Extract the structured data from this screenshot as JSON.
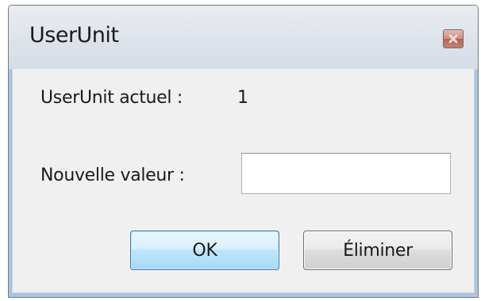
{
  "window": {
    "title": "UserUnit"
  },
  "content": {
    "current_label": "UserUnit actuel :",
    "current_value": "1",
    "new_label": "Nouvelle valeur :",
    "new_value": "",
    "new_placeholder": ""
  },
  "buttons": {
    "ok_label": "OK",
    "delete_label": "Éliminer"
  },
  "icons": {
    "close": "close-icon"
  },
  "colors": {
    "ok_border": "#3c7fb1",
    "close_red": "#c97f74"
  }
}
